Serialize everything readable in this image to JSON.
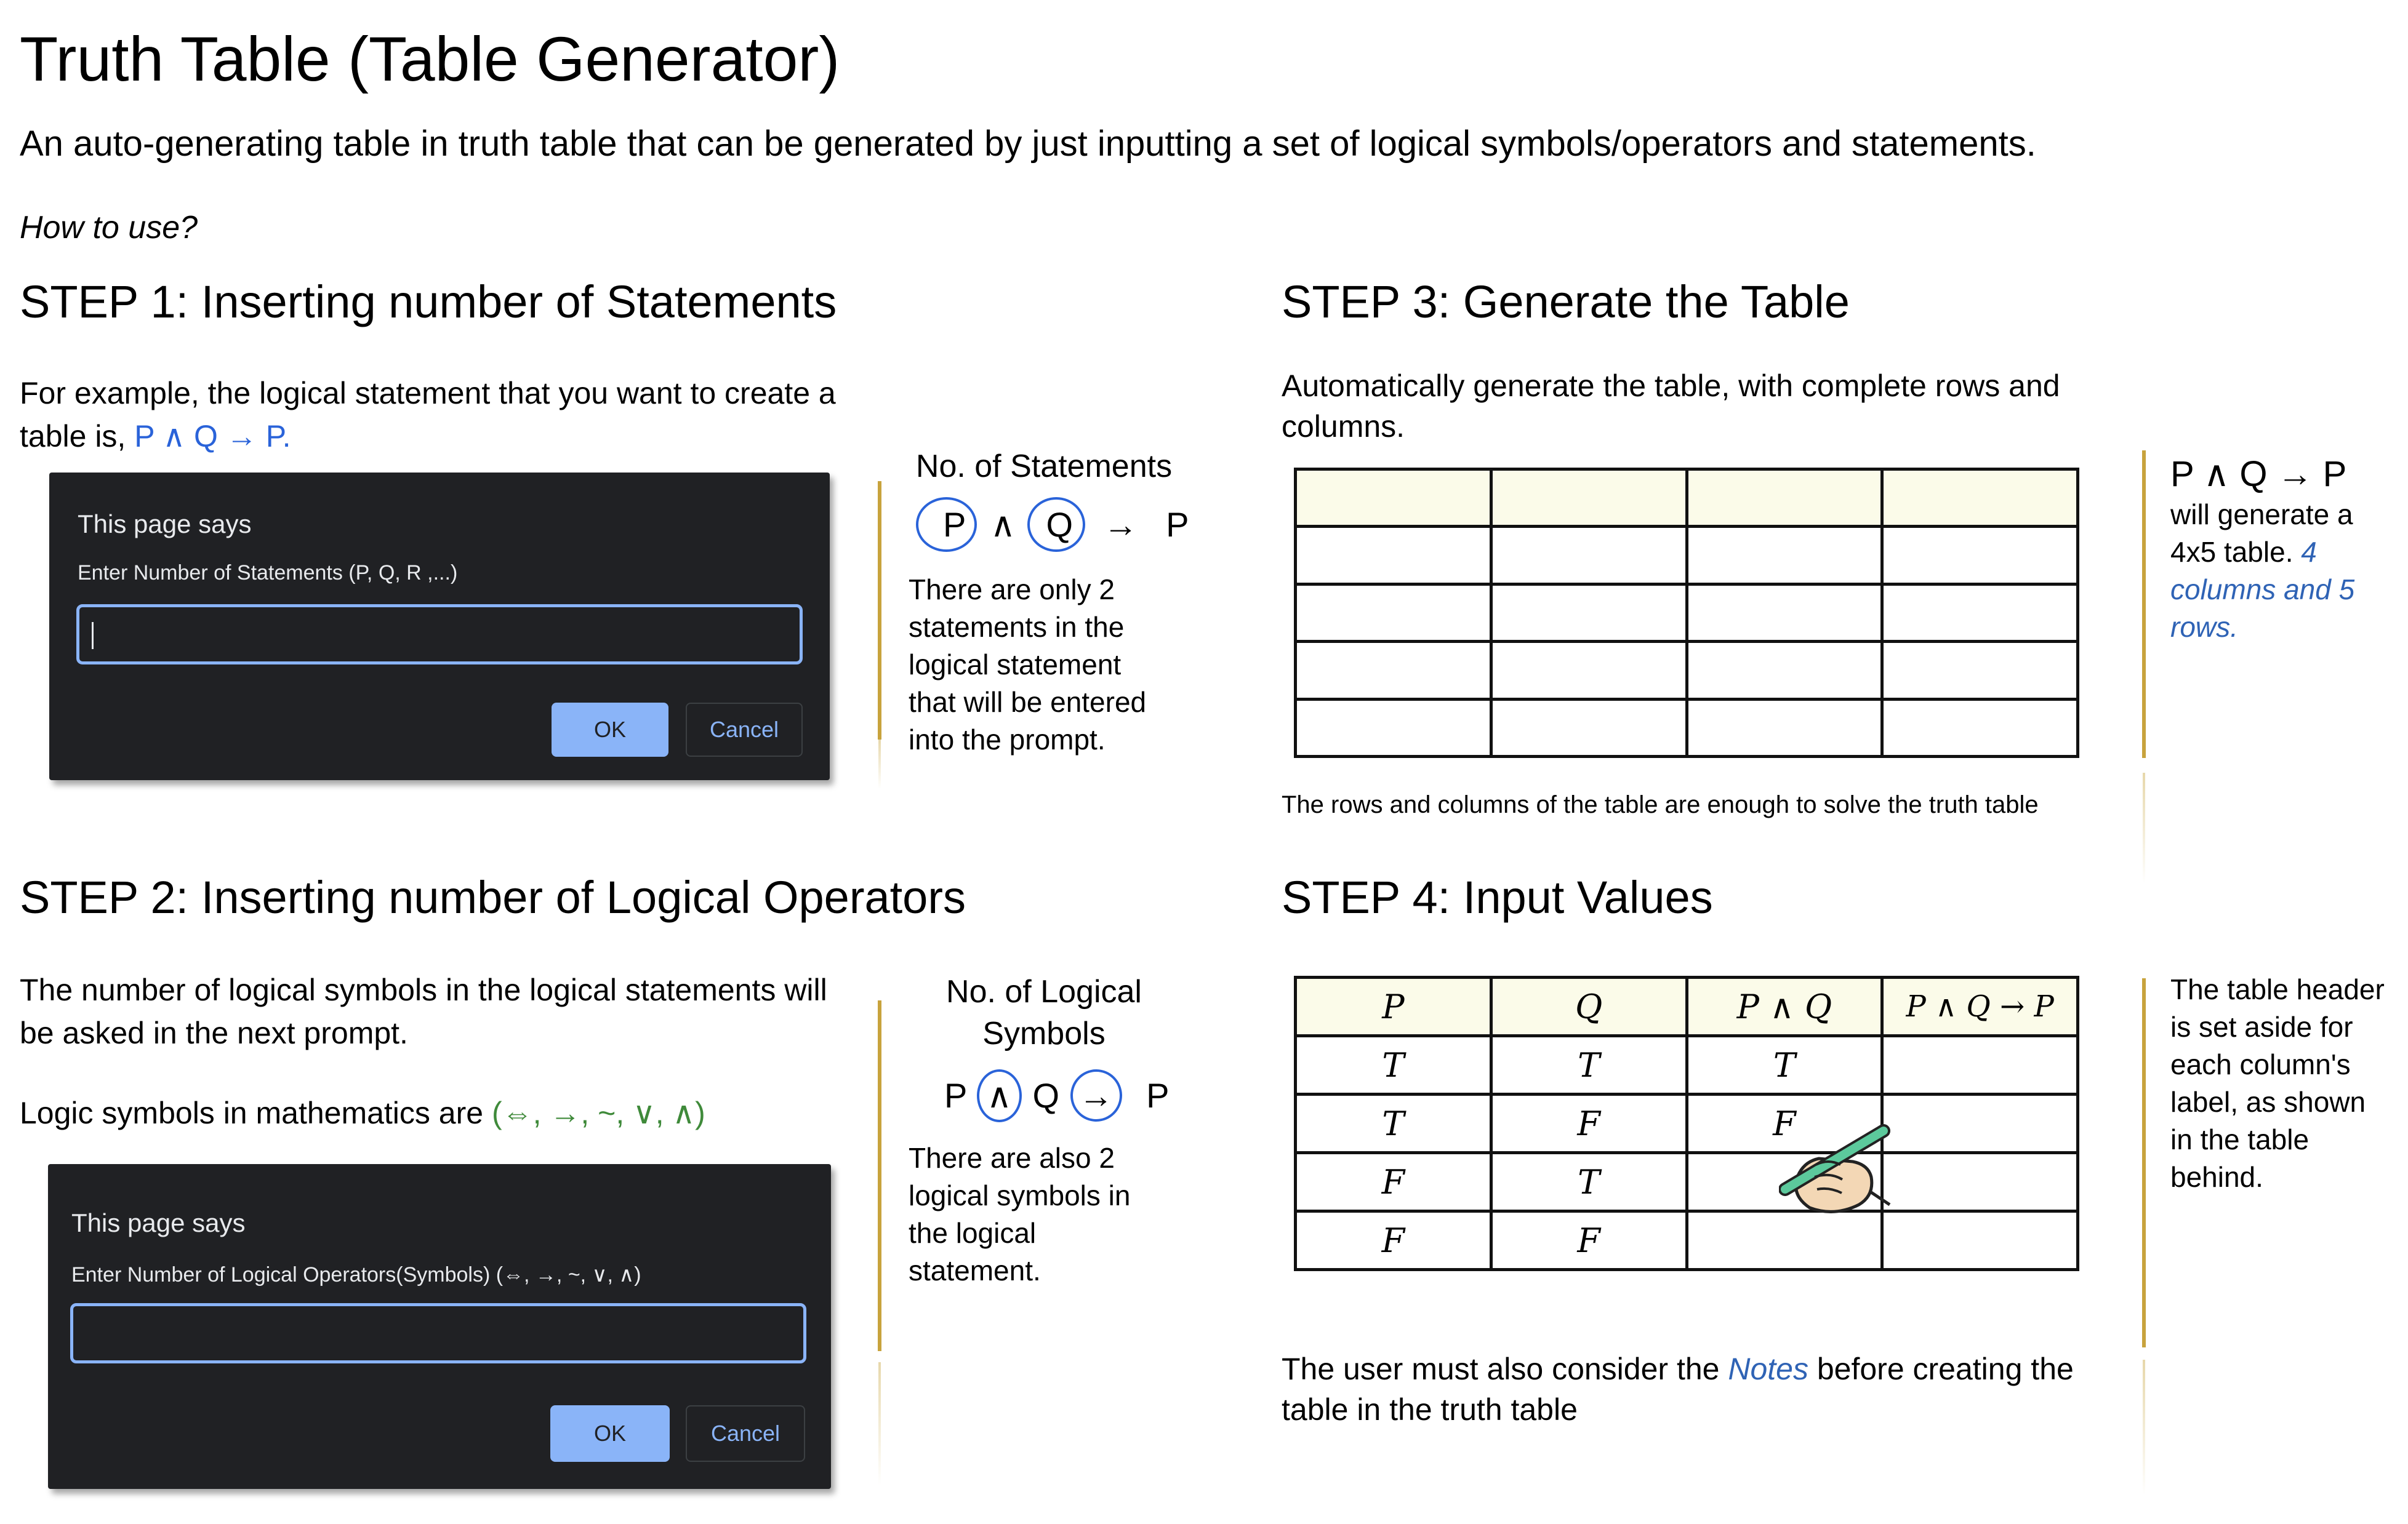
{
  "title": "Truth Table (Table Generator)",
  "subtitle": "An auto-generating table in truth table that can be generated by just inputting a set of logical symbols/operators and statements.",
  "how_to_use": "How to use?",
  "step1": {
    "heading": "STEP 1: Inserting number of Statements",
    "text_line1": "For example, the logical statement that you want to create a",
    "text_line2": "table is, ",
    "example_statement": "P ∧ Q → P.",
    "dialog": {
      "title": "This page says",
      "prompt": "Enter Number of Statements (P, Q, R ,...)",
      "input_value": "",
      "ok_label": "OK",
      "cancel_label": "Cancel"
    },
    "side": {
      "label": "No. of Statements",
      "formula": [
        "P",
        "∧",
        "Q",
        "→",
        "P"
      ],
      "note_lines": [
        "There are only 2",
        "statements in the",
        "logical statement",
        "that will be entered",
        "into the prompt."
      ]
    }
  },
  "step2": {
    "heading": "STEP 2: Inserting number of Logical Operators",
    "text_line1": "The number of logical symbols in the logical statements will",
    "text_line2": "be asked in the next prompt.",
    "symbols_prefix": "Logic symbols in mathematics are ",
    "symbols_list": "(⇔, →, ~, ∨, ∧)",
    "dialog": {
      "title": "This page says",
      "prompt": "Enter Number of Logical Operators(Symbols) (⇔, →, ~, ∨, ∧)",
      "input_value": "",
      "ok_label": "OK",
      "cancel_label": "Cancel"
    },
    "side": {
      "label_line1": "No. of Logical",
      "label_line2": "Symbols",
      "formula": [
        "P",
        "∧",
        "Q",
        "→",
        "P"
      ],
      "note_lines": [
        "There are also 2",
        "logical symbols in",
        "the logical",
        "statement."
      ]
    }
  },
  "step3": {
    "heading": "STEP 3: Generate the Table",
    "text_line1": "Automatically generate the table, with complete rows and",
    "text_line2": "columns.",
    "caption": "The rows and columns of the table are enough to solve the truth table",
    "side": {
      "formula": "P ∧ Q → P",
      "note_line1": "will generate a",
      "note_line2": "4x5 table. ",
      "note_highlight1": "4",
      "note_highlight2": "columns and 5",
      "note_highlight3": "rows."
    }
  },
  "step4": {
    "heading": "STEP 4: Input Values",
    "table": {
      "headers": [
        "P",
        "Q",
        "P ∧ Q",
        "P ∧ Q → P"
      ],
      "rows": [
        [
          "T",
          "T",
          "T",
          ""
        ],
        [
          "T",
          "F",
          "F",
          ""
        ],
        [
          "F",
          "T",
          "",
          ""
        ],
        [
          "F",
          "F",
          "",
          ""
        ]
      ]
    },
    "text_prefix": "The user must also consider the ",
    "text_link": "Notes",
    "text_suffix": " before creating the",
    "text_line2": "table in the truth table",
    "side": {
      "note_lines": [
        "The table header",
        "is set aside for",
        "each column's",
        "label, as shown",
        "in the table",
        "behind."
      ]
    }
  }
}
